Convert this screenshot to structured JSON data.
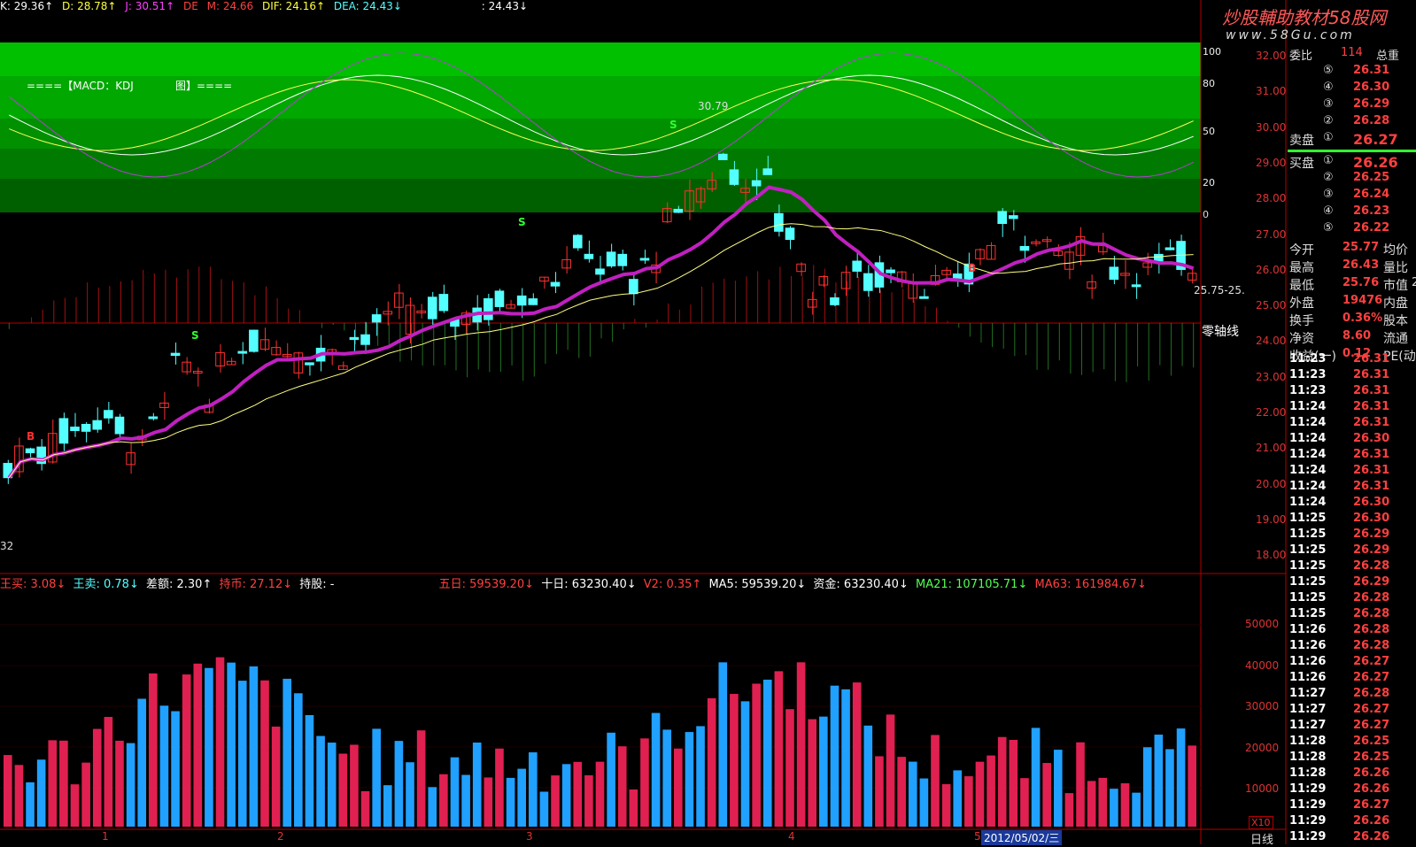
{
  "watermark": {
    "title": "炒股輔助教材58股网",
    "url": "www.58Gu.com"
  },
  "indicator_header": {
    "k": "K: 29.36↑",
    "d": "D: 28.78↑",
    "j": "J: 30.51↑",
    "de": "DE",
    "m": "M: 24.66",
    "dif": "DIF: 24.16↑",
    "dea": "DEA: 24.43↓",
    "extra": ": 24.43↓"
  },
  "chart_labels": {
    "macd_kdj": "====【MACD：KDJ",
    "tu": "图】====",
    "kdj_levels": [
      "100",
      "80",
      "50",
      "20",
      "0"
    ],
    "price_note": "30.79",
    "price_range": "25.75-25.",
    "zero_axis": "零轴线",
    "bottom_left_num": "32"
  },
  "price_axis": [
    "32.00",
    "31.00",
    "30.00",
    "29.00",
    "28.00",
    "27.00",
    "26.00",
    "25.00",
    "24.00",
    "23.00",
    "22.00",
    "21.00",
    "20.00",
    "19.00",
    "18.00"
  ],
  "volume_header": {
    "zhu_mai": "王买: 3.08↓",
    "zhu_mai2": "王卖: 0.78↓",
    "cha_e": "差额: 2.30↑",
    "chi_bi": "持币: 27.12↓",
    "chi_gu": "持股: -",
    "wu_ri": "五日: 59539.20↓",
    "shi_ri": "十日: 63230.40↓",
    "v2": "V2: 0.35↑",
    "ma5": "MA5: 59539.20↓",
    "zi_jin": "资金: 63230.40↓",
    "ma21": "MA21: 107105.71↓",
    "ma63": "MA63: 161984.67↓"
  },
  "volume_axis": [
    "50000",
    "40000",
    "30000",
    "20000",
    "10000"
  ],
  "volume_unit": "X10",
  "x_labels": [
    "1",
    "2",
    "3",
    "4",
    "5"
  ],
  "date_label": "2012/05/02/三",
  "period_label": "日线",
  "quote": {
    "weibi_label": "委比",
    "weibi_value": "114",
    "zong_label": "总重",
    "sell_label": "卖盘",
    "buy_label": "买盘",
    "sells": [
      {
        "n": "⑤",
        "p": "26.31"
      },
      {
        "n": "④",
        "p": "26.30"
      },
      {
        "n": "③",
        "p": "26.29"
      },
      {
        "n": "②",
        "p": "26.28"
      },
      {
        "n": "①",
        "p": "26.27"
      }
    ],
    "buys": [
      {
        "n": "①",
        "p": "26.26"
      },
      {
        "n": "②",
        "p": "26.25"
      },
      {
        "n": "③",
        "p": "26.24"
      },
      {
        "n": "④",
        "p": "26.23"
      },
      {
        "n": "⑤",
        "p": "26.22"
      }
    ],
    "stats": [
      {
        "l1": "今开",
        "v1": "25.77",
        "l2": "均价"
      },
      {
        "l1": "最高",
        "v1": "26.43",
        "l2": "量比"
      },
      {
        "l1": "最低",
        "v1": "25.76",
        "l2": "市值",
        "v2": "2"
      },
      {
        "l1": "外盘",
        "v1": "19476",
        "l2": "内盘"
      },
      {
        "l1": "换手",
        "v1": "0.36%",
        "l2": "股本"
      },
      {
        "l1": "净资",
        "v1": "8.60",
        "l2": "流通"
      },
      {
        "l1": "收益(一)",
        "v1": "0.12",
        "l2": "PE(动)"
      }
    ],
    "ticks": [
      [
        "11:23",
        "26.31"
      ],
      [
        "11:23",
        "26.31"
      ],
      [
        "11:23",
        "26.31"
      ],
      [
        "11:24",
        "26.31"
      ],
      [
        "11:24",
        "26.31"
      ],
      [
        "11:24",
        "26.30"
      ],
      [
        "11:24",
        "26.31"
      ],
      [
        "11:24",
        "26.31"
      ],
      [
        "11:24",
        "26.31"
      ],
      [
        "11:24",
        "26.30"
      ],
      [
        "11:25",
        "26.30"
      ],
      [
        "11:25",
        "26.29"
      ],
      [
        "11:25",
        "26.29"
      ],
      [
        "11:25",
        "26.28"
      ],
      [
        "11:25",
        "26.29"
      ],
      [
        "11:25",
        "26.28"
      ],
      [
        "11:25",
        "26.28"
      ],
      [
        "11:26",
        "26.28"
      ],
      [
        "11:26",
        "26.28"
      ],
      [
        "11:26",
        "26.27"
      ],
      [
        "11:26",
        "26.27"
      ],
      [
        "11:27",
        "26.28"
      ],
      [
        "11:27",
        "26.27"
      ],
      [
        "11:27",
        "26.27"
      ],
      [
        "11:28",
        "26.25"
      ],
      [
        "11:28",
        "26.25"
      ],
      [
        "11:28",
        "26.26"
      ],
      [
        "11:29",
        "26.26"
      ],
      [
        "11:29",
        "26.27"
      ],
      [
        "11:29",
        "26.26"
      ],
      [
        "11:29",
        "26.26"
      ]
    ]
  },
  "colors": {
    "up": "#ff3030",
    "down": "#54ffff",
    "bg": "#000000",
    "grid": "#b00000",
    "band": "#00c000"
  }
}
